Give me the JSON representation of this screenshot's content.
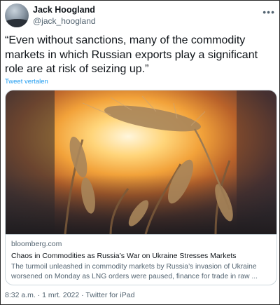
{
  "author": {
    "name": "Jack Hoogland",
    "handle": "@jack_hoogland",
    "more_icon": "more-horizontal-icon"
  },
  "tweet": {
    "text": "“Even without sanctions, many of the commodity markets in which Russian exports play a significant role are at risk of seizing up.”",
    "translate_label": "Tweet vertalen"
  },
  "card": {
    "image_alt": "wheat-ears-at-sunset",
    "domain": "bloomberg.com",
    "title": "Chaos in Commodities as Russia’s War on Ukraine Stresses Markets",
    "description": "The turmoil unleashed in commodity markets by Russia’s invasion of Ukraine worsened on Monday as LNG orders were paused, finance for trade in raw ..."
  },
  "footer": {
    "time": "8:32 a.m.",
    "separator": " · ",
    "date": "1 mrt. 2022",
    "source": "Twitter for iPad"
  },
  "colors": {
    "link": "#1d9bf0",
    "secondary_text": "#536471",
    "primary_text": "#0f1419",
    "border": "#cfd9de"
  }
}
